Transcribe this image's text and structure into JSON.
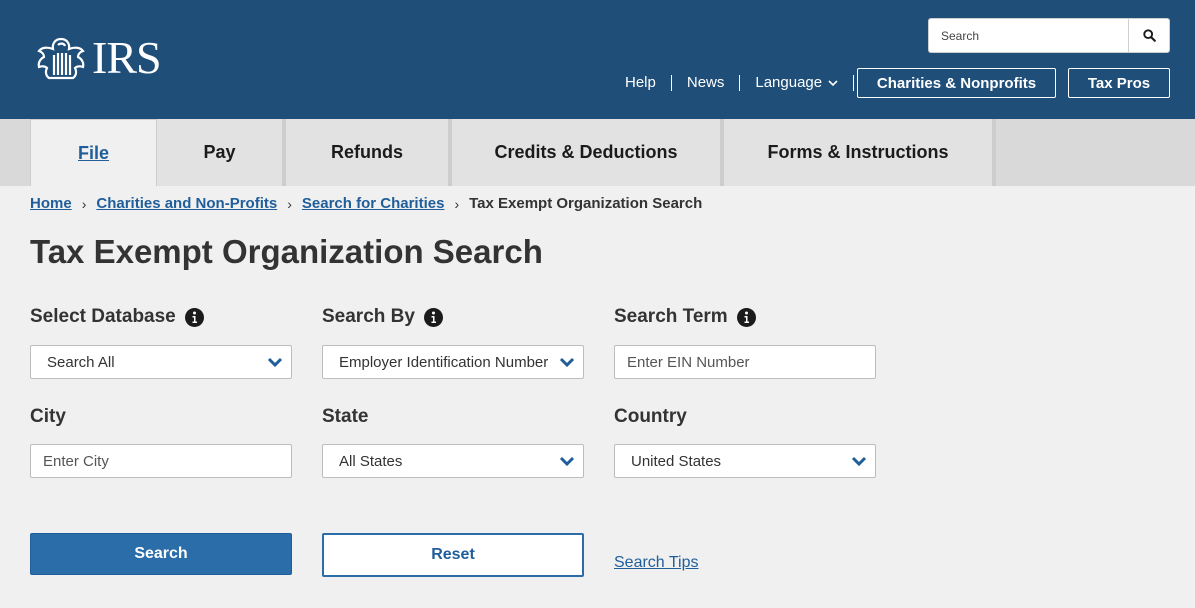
{
  "header": {
    "logo_text": "IRS",
    "search_placeholder": "Search",
    "util_links": [
      "Help",
      "News",
      "Language"
    ],
    "charities_button": "Charities & Nonprofits",
    "taxpros_button": "Tax Pros"
  },
  "nav": {
    "tabs": [
      "File",
      "Pay",
      "Refunds",
      "Credits & Deductions",
      "Forms & Instructions"
    ],
    "active": "File"
  },
  "breadcrumb": {
    "links": [
      "Home",
      "Charities and Non-Profits",
      "Search for Charities"
    ],
    "current": "Tax Exempt Organization Search"
  },
  "page_title": "Tax Exempt Organization Search",
  "form": {
    "database_label": "Select Database",
    "database_value": "Search All",
    "search_by_label": "Search By",
    "search_by_value": "Employer Identification Number",
    "search_term_label": "Search Term",
    "search_term_placeholder": "Enter EIN Number",
    "city_label": "City",
    "city_placeholder": "Enter City",
    "state_label": "State",
    "state_value": "All States",
    "country_label": "Country",
    "country_value": "United States",
    "search_button": "Search",
    "reset_button": "Reset",
    "search_tips": "Search Tips"
  },
  "colors": {
    "header_bg": "#1f4e79",
    "link": "#1f5e9a",
    "primary_button": "#2a6da8"
  },
  "icons": [
    "irs-eagle-logo-icon",
    "search-icon",
    "chevron-down-icon",
    "info-icon"
  ]
}
